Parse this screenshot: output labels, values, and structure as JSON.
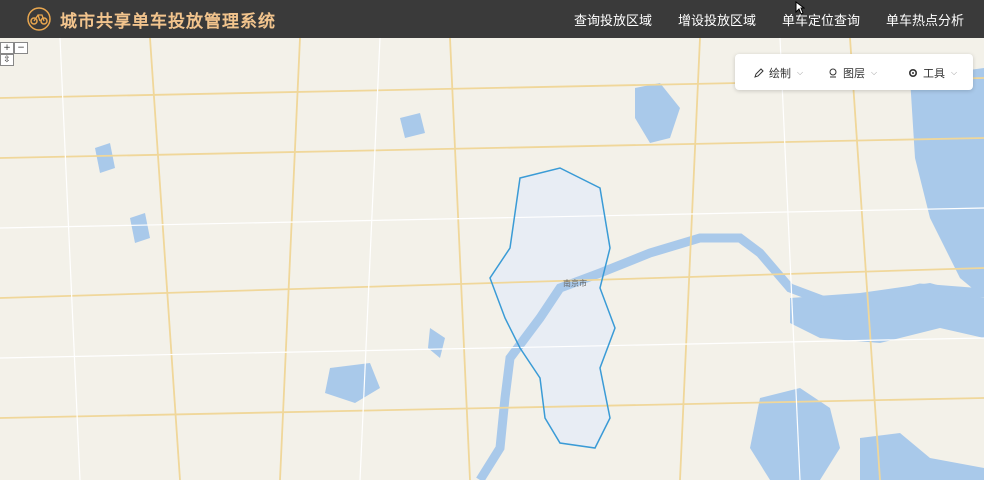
{
  "header": {
    "title": "城市共享单车投放管理系统",
    "logo_icon": "bicycle-icon",
    "nav": [
      {
        "label": "查询投放区域"
      },
      {
        "label": "增设投放区域"
      },
      {
        "label": "单车定位查询"
      },
      {
        "label": "单车热点分析"
      }
    ]
  },
  "map": {
    "region_label": "南京市",
    "zoom_in": "+",
    "zoom_out": "−",
    "zoom_third": "⇳"
  },
  "toolbar": {
    "draw_label": "绘制",
    "layers_label": "图层",
    "tools_label": "工具"
  },
  "colors": {
    "header_bg": "#3a3a3a",
    "title": "#f2c48d",
    "water": "#a9c9ea",
    "boundary": "#3a9bd6"
  }
}
